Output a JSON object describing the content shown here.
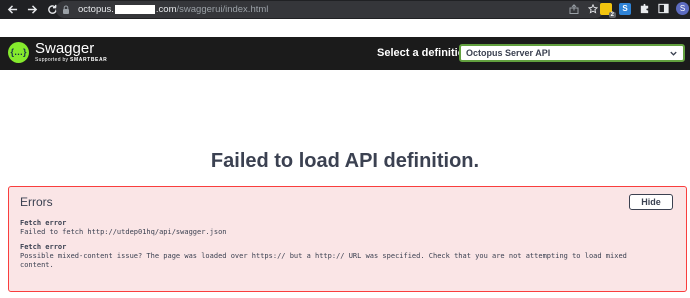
{
  "browser": {
    "url_host_prefix": "octopus.",
    "url_host_suffix": ".com",
    "url_path": "/swaggerui/index.html",
    "extension_badge": "2",
    "extension_s_label": "S",
    "profile_initial": "S"
  },
  "header": {
    "logo_title": "Swagger",
    "logo_subtitle_prefix": "Supported by",
    "logo_subtitle_brand": "SMARTBEAR",
    "definition_label": "Select a definition",
    "definition_selected": "Octopus Server API",
    "accent_color": "#85ea2d"
  },
  "main": {
    "failure_title": "Failed to load API definition."
  },
  "errors": {
    "title": "Errors",
    "hide_label": "Hide",
    "items": [
      {
        "heading": "Fetch error",
        "message": "Failed to fetch http://utdep01hq/api/swagger.json"
      },
      {
        "heading": "Fetch error",
        "message": "Possible mixed-content issue? The page was loaded over https:// but a http:// URL was specified. Check that you are not attempting to load mixed content."
      }
    ]
  }
}
